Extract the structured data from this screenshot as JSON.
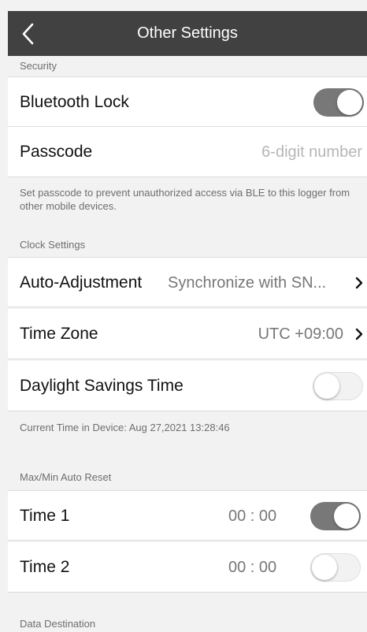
{
  "header": {
    "title": "Other Settings",
    "back_icon": "chevron-left-icon"
  },
  "security": {
    "header": "Security",
    "bluetooth_lock": {
      "label": "Bluetooth Lock",
      "enabled": true
    },
    "passcode": {
      "label": "Passcode",
      "placeholder": "6-digit number"
    },
    "note": "Set passcode to prevent unauthorized access via BLE to this logger from other mobile devices."
  },
  "clock": {
    "header": "Clock Settings",
    "auto_adjustment": {
      "label": "Auto-Adjustment",
      "value": "Synchronize with SN..."
    },
    "time_zone": {
      "label": "Time Zone",
      "value": "UTC +09:00"
    },
    "dst": {
      "label": "Daylight Savings Time",
      "enabled": false
    },
    "current_time": "Current Time in Device: Aug 27,2021 13:28:46"
  },
  "maxmin": {
    "header": "Max/Min Auto Reset",
    "time1": {
      "label": "Time 1",
      "value": "00 : 00",
      "enabled": true
    },
    "time2": {
      "label": "Time 2",
      "value": "00 : 00",
      "enabled": false
    }
  },
  "data_destination": {
    "header": "Data Destination"
  },
  "colors": {
    "navbar": "#414141",
    "toggle_on": "#787878",
    "background": "#f2f2f2"
  }
}
